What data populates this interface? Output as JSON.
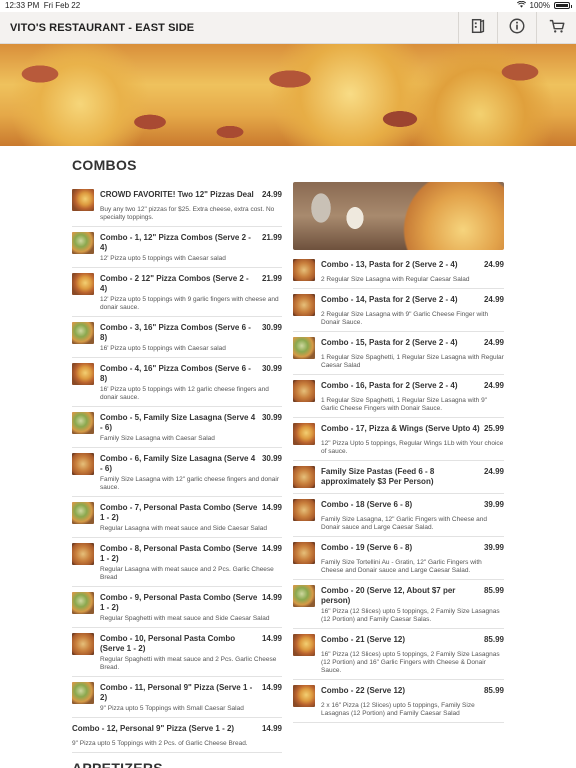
{
  "status": {
    "time": "12:33 PM",
    "date": "Fri Feb 22",
    "battery": "100%"
  },
  "header": {
    "title": "VITO'S RESTAURANT - EAST SIDE"
  },
  "icons": {
    "store": "store-icon",
    "info": "info-icon",
    "cart": "cart-icon"
  },
  "sections": {
    "combos": "COMBOS",
    "appetizers": "APPETIZERS"
  },
  "left_items": [
    {
      "name": "CROWD FAVORITE! Two 12\" Pizzas Deal",
      "price": "24.99",
      "desc": "Buy any two 12\" pizzas for $25. Extra cheese, extra cost. No specialty toppings.",
      "thumb": "pizza"
    },
    {
      "name": "Combo - 1, 12\" Pizza Combos (Serve 2 - 4)",
      "price": "21.99",
      "desc": "12' Pizza upto 5 toppings with Caesar salad",
      "thumb": "salad"
    },
    {
      "name": "Combo - 2 12\" Pizza Combos (Serve 2 - 4)",
      "price": "21.99",
      "desc": "12' Pizza upto 5 toppings with 9 garlic fingers with cheese and donair sauce.",
      "thumb": "pizza"
    },
    {
      "name": "Combo - 3, 16\" Pizza Combos (Serve 6 - 8)",
      "price": "30.99",
      "desc": "16' Pizza upto 5 toppings with Caesar salad",
      "thumb": "salad"
    },
    {
      "name": "Combo - 4, 16\" Pizza Combos (Serve 6 - 8)",
      "price": "30.99",
      "desc": "16' Pizza upto 5 toppings with 12 garlic cheese fingers and donair sauce.",
      "thumb": "pizza"
    },
    {
      "name": "Combo - 5, Family Size Lasagna (Serve 4 - 6)",
      "price": "30.99",
      "desc": "Family Size Lasagna with Caesar Salad",
      "thumb": "salad"
    },
    {
      "name": "Combo - 6, Family Size Lasagna (Serve 4 - 6)",
      "price": "30.99",
      "desc": "Family Size Lasagna with 12\" garlic cheese fingers and donair sauce.",
      "thumb": "pasta"
    },
    {
      "name": "Combo - 7, Personal Pasta Combo (Serve 1 - 2)",
      "price": "14.99",
      "desc": "Regular Lasagna with meat sauce and Side Caesar Salad",
      "thumb": "salad"
    },
    {
      "name": "Combo - 8, Personal Pasta Combo (Serve 1 - 2)",
      "price": "14.99",
      "desc": "Regular Lasagna with meat sauce and 2 Pcs. Garlic Cheese Bread",
      "thumb": "pasta"
    },
    {
      "name": "Combo - 9, Personal Pasta Combo (Serve 1 - 2)",
      "price": "14.99",
      "desc": "Regular Spaghetti with meat sauce and Side Caesar Salad",
      "thumb": "salad"
    },
    {
      "name": "Combo - 10, Personal Pasta Combo (Serve 1 - 2)",
      "price": "14.99",
      "desc": "Regular Spaghetti with meat sauce and 2 Pcs. Garlic Cheese Bread.",
      "thumb": "pasta"
    },
    {
      "name": "Combo - 11, Personal 9\" Pizza (Serve 1 - 2)",
      "price": "14.99",
      "desc": "9\" Pizza upto 5 Toppings with Small Caesar Salad",
      "thumb": "salad"
    },
    {
      "name": "Combo - 12, Personal 9\" Pizza (Serve 1 - 2)",
      "price": "14.99",
      "desc": "9\" Pizza upto 5 Toppings with 2 Pcs. of Garlic Cheese Bread.",
      "thumb": "none"
    }
  ],
  "right_items": [
    {
      "name": "Combo - 13, Pasta for 2 (Serve 2 - 4)",
      "price": "24.99",
      "desc": "2 Regular Size Lasagna with Regular Caesar Salad",
      "thumb": "pasta"
    },
    {
      "name": "Combo - 14, Pasta for 2 (Serve 2 - 4)",
      "price": "24.99",
      "desc": "2 Regular Size Lasagna with 9\" Garlic Cheese Finger with Donair Sauce.",
      "thumb": "pasta"
    },
    {
      "name": "Combo - 15, Pasta for 2 (Serve 2 - 4)",
      "price": "24.99",
      "desc": "1 Regular Size Spaghetti, 1 Regular Size Lasagna with Regular Caesar Salad",
      "thumb": "salad"
    },
    {
      "name": "Combo - 16, Pasta for 2 (Serve 2 - 4)",
      "price": "24.99",
      "desc": "1 Regular Size Spaghetti, 1 Regular Size Lasagna with 9\" Garlic Cheese Fingers with Donair Sauce.",
      "thumb": "pasta"
    },
    {
      "name": "Combo - 17, Pizza & Wings (Serve Upto 4)",
      "price": "25.99",
      "desc": "12\" Pizza Upto 5 toppings, Regular Wings 1Lb with Your choice of sauce.",
      "thumb": "pizza"
    },
    {
      "name": "Family Size Pastas (Feed 6 - 8 approximately $3 Per Person)",
      "price": "24.99",
      "desc": "",
      "thumb": "pasta"
    },
    {
      "name": "Combo - 18 (Serve 6 - 8)",
      "price": "39.99",
      "desc": "Family Size Lasagna, 12\" Garlic Fingers with Cheese and Donair sauce and Large Caesar Salad.",
      "thumb": "pasta"
    },
    {
      "name": "Combo - 19 (Serve 6 - 8)",
      "price": "39.99",
      "desc": "Family Size Tortellini Au - Gratin, 12\" Garlic Fingers with Cheese and Donair sauce and Large Caesar Salad.",
      "thumb": "pasta"
    },
    {
      "name": "Combo - 20 (Serve 12, About $7 per person)",
      "price": "85.99",
      "desc": "16\" Pizza (12 Slices) upto 5 toppings, 2 Family Size Lasagnas (12 Portion) and Family Caesar Salas.",
      "thumb": "salad"
    },
    {
      "name": "Combo - 21 (Serve 12)",
      "price": "85.99",
      "desc": "16\" Pizza (12 Slices) upto 5 toppings, 2 Family Size Lasagnas (12 Portion) and 16\" Garlic Fingers with Cheese & Donair Sauce.",
      "thumb": "pizza"
    },
    {
      "name": "Combo - 22 (Serve 12)",
      "price": "85.99",
      "desc": "2 x 16\" Pizza (12 Slices) upto 5 toppings, Family Size Lasagnas (12 Portion) and Family Caesar Salad",
      "thumb": "pizza"
    }
  ]
}
